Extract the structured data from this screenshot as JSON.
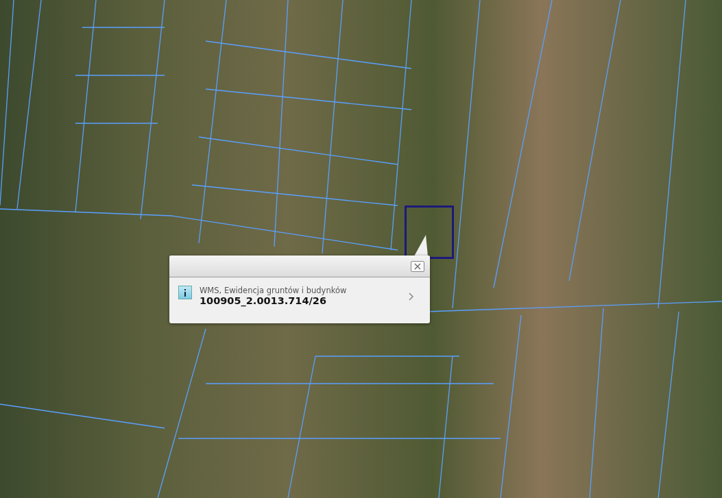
{
  "popup": {
    "source": "WMS, Ewidencja gruntów i budynków",
    "parcel_id": "100905_2.0013.714/26"
  }
}
